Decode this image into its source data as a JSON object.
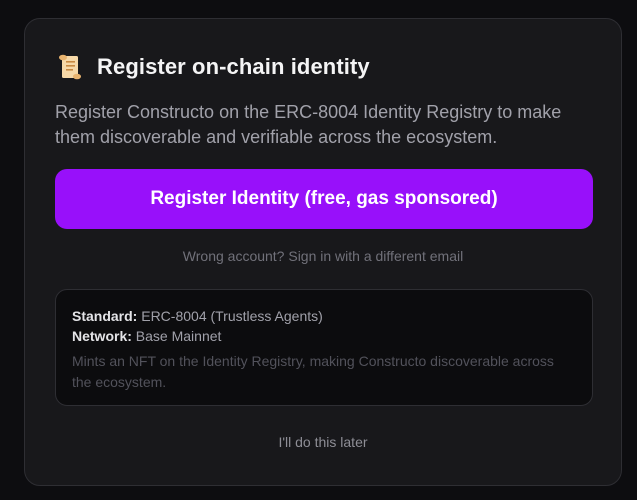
{
  "dialog": {
    "icon": "scroll-icon",
    "title": "Register on-chain identity",
    "description": "Register Constructo on the ERC-8004 Identity Registry to make them discoverable and verifiable across the ecosystem."
  },
  "actions": {
    "register_label": "Register Identity (free, gas sponsored)",
    "switch_account_text": "Wrong account? Sign in with a different email",
    "later_label": "I'll do this later"
  },
  "info": {
    "standard_label": "Standard:",
    "standard_value": "ERC-8004 (Trustless Agents)",
    "network_label": "Network:",
    "network_value": "Base Mainnet",
    "note": "Mints an NFT on the Identity Registry, making Constructo discoverable across the ecosystem."
  },
  "colors": {
    "accent": "#9810fa",
    "background": "#0d0d10",
    "card": "#18181b"
  }
}
